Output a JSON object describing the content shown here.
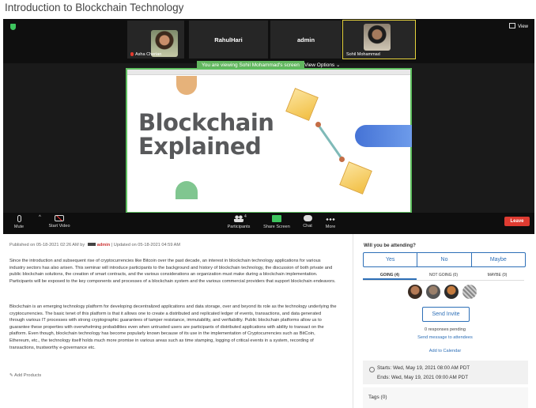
{
  "page": {
    "title": "Introduction to Blockchain Technology"
  },
  "meeting": {
    "view_label": "View",
    "participants": [
      {
        "name": "Asha Cherian",
        "muted": true
      },
      {
        "name": "RahulHari"
      },
      {
        "name": "admin"
      },
      {
        "name": "Sohil Mohammad"
      }
    ],
    "share_banner": "You are viewing Sohil Mohammad's screen",
    "view_options": "View Options",
    "slide": {
      "line1": "Blockchain",
      "line2": "Explained"
    },
    "toolbar": {
      "mute": "Mute",
      "start_video": "Start Video",
      "participants": "Participants",
      "participants_count": "4",
      "share_screen": "Share Screen",
      "chat": "Chat",
      "more": "More",
      "leave": "Leave"
    }
  },
  "post": {
    "published_prefix": "Published on 05-18-2021 02:26 AM by",
    "author": "admin",
    "updated": "| Updated on 05-18-2021 04:59 AM",
    "paragraph1": "Since the introduction and subsequent rise of cryptocurrencies like Bitcoin over the past decade, an interest in blockchain technology applications for various industry sectors has also arisen. This seminar will introduce participants to the background and history of blockchain technology, the discussion of both private and public blockchain solutions, the creation of smart contracts, and the various considerations an organization must make during a blockchain implementation. Participants will be exposed to the key components and processes of a blockchain system and the various commercial providers that support blockchain endeavors.",
    "paragraph2": "Blockchain is an emerging technology platform for developing decentralized applications and data storage, over and beyond its role as the technology underlying the cryptocurrencies. The basic tenet of this platform is that it allows one to create a distributed and replicated ledger of events, transactions, and data generated through various IT processes with strong cryptographic guarantees of tamper resistance, immutability, and verifiability. Public blockchain platforms allow us to guarantee these properties with overwhelming probabilities even when untrusted users are participants of distributed applications with ability to transact on the platform. Even though, blockchain technology has become popularly known because of its use in the implementation of Cryptocurrencies such as BitCoin, Ethereum, etc., the technology itself holds much more promise in various areas such as time stamping, logging of critical events in a system, recording of transactions, trustworthy e-governance etc.",
    "add_products": "Add Products"
  },
  "rsvp": {
    "question": "Will you be attending?",
    "options": [
      "Yes",
      "No",
      "Maybe"
    ],
    "tabs": [
      "GOING (4)",
      "NOT GOING (0)",
      "MAYBE (0)"
    ],
    "send_invite": "Send Invite",
    "pending": "0 responses pending",
    "send_message": "Send message to attendees",
    "add_calendar": "Add to Calendar",
    "starts": "Starts: Wed, May 19, 2021 08:00 AM PDT",
    "ends": "Ends: Wed, May 19, 2021 09:00 AM PDT",
    "tags": "Tags (0)"
  }
}
